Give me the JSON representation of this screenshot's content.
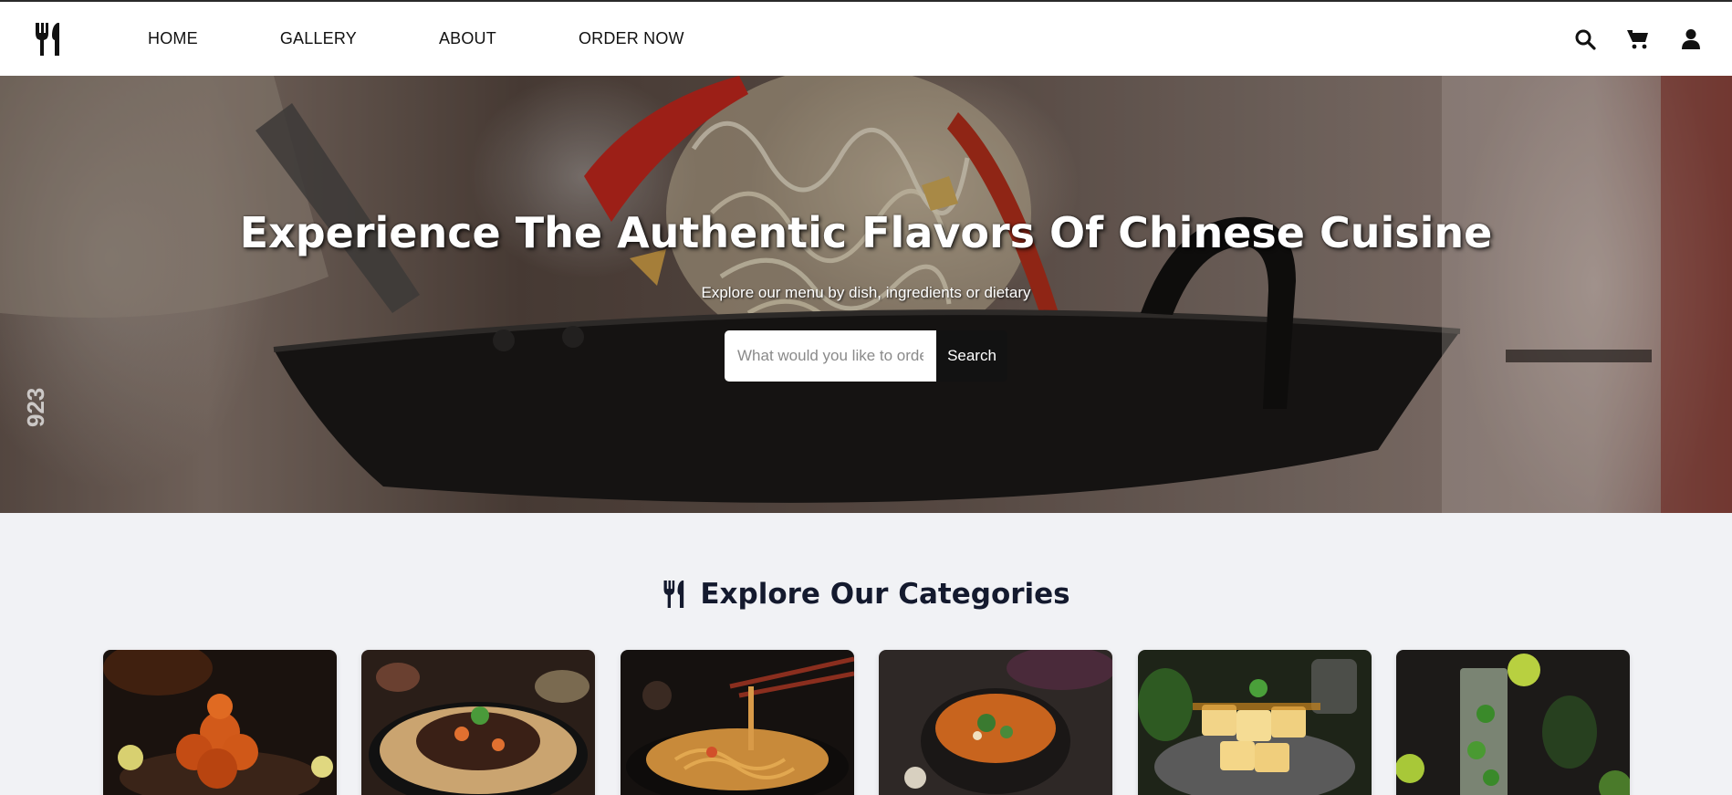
{
  "nav": {
    "logo_icon": "utensils-icon",
    "links": [
      {
        "label": "HOME"
      },
      {
        "label": "GALLERY"
      },
      {
        "label": "ABOUT"
      },
      {
        "label": "ORDER NOW"
      }
    ],
    "icons": [
      "search-icon",
      "cart-icon",
      "user-icon"
    ]
  },
  "hero": {
    "title": "Experience The Authentic Flavors Of Chinese Cuisine",
    "subtitle": "Explore our menu by dish, ingredients or dietary",
    "search": {
      "placeholder": "What would you like to order?",
      "button_label": "Search"
    },
    "watermark_text": "923"
  },
  "categories": {
    "heading_icon": "utensils-icon",
    "title": "Explore Our Categories",
    "cards": [
      {
        "image": "fried-shrimp"
      },
      {
        "image": "beef-fried-rice"
      },
      {
        "image": "noodles-chopsticks"
      },
      {
        "image": "soup-bowl"
      },
      {
        "image": "tofu-dessert"
      },
      {
        "image": "mojito-drink"
      }
    ]
  },
  "colors": {
    "nav_bg": "#ffffff",
    "page_bg": "#f1f2f5",
    "button_bg": "#121212",
    "heading_text": "#141a2e"
  }
}
